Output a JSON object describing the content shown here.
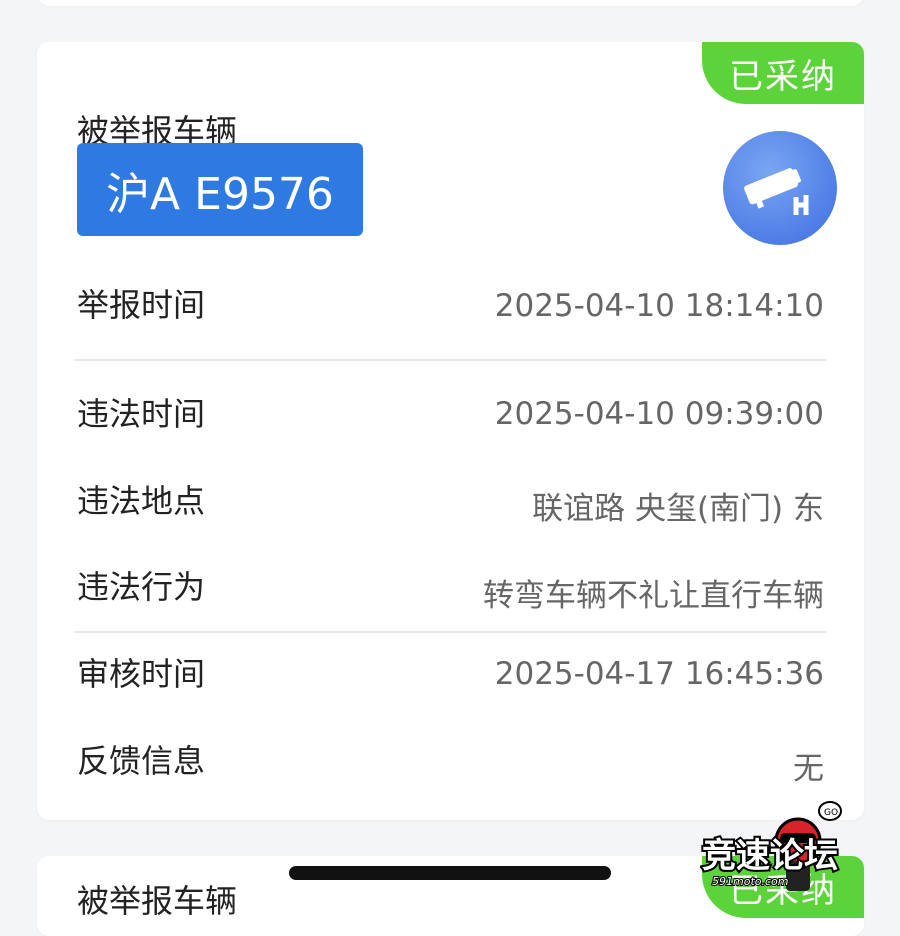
{
  "report_card": {
    "status_badge": "已采纳",
    "section_title": "被举报车辆",
    "plate_number": "沪A E9576",
    "plate_color": "#2f79e2",
    "badge_color": "#5cd33a",
    "camera_icon": "surveillance-camera-icon",
    "rows": {
      "report_time": {
        "label": "举报时间",
        "value": "2025-04-10 18:14:10"
      },
      "violation_time": {
        "label": "违法时间",
        "value": "2025-04-10 09:39:00"
      },
      "violation_location": {
        "label": "违法地点",
        "value": "联谊路 央玺(南门) 东"
      },
      "violation_behavior": {
        "label": "违法行为",
        "value": "转弯车辆不礼让直行车辆"
      },
      "review_time": {
        "label": "审核时间",
        "value": "2025-04-17 16:45:36"
      },
      "feedback": {
        "label": "反馈信息",
        "value": "无"
      }
    }
  },
  "next_card": {
    "section_title": "被举报车辆",
    "status_badge": "已采纳"
  },
  "watermark": {
    "brand_text": "竞速论坛",
    "site_text": "591moto.com",
    "bubble_text": "GO"
  }
}
